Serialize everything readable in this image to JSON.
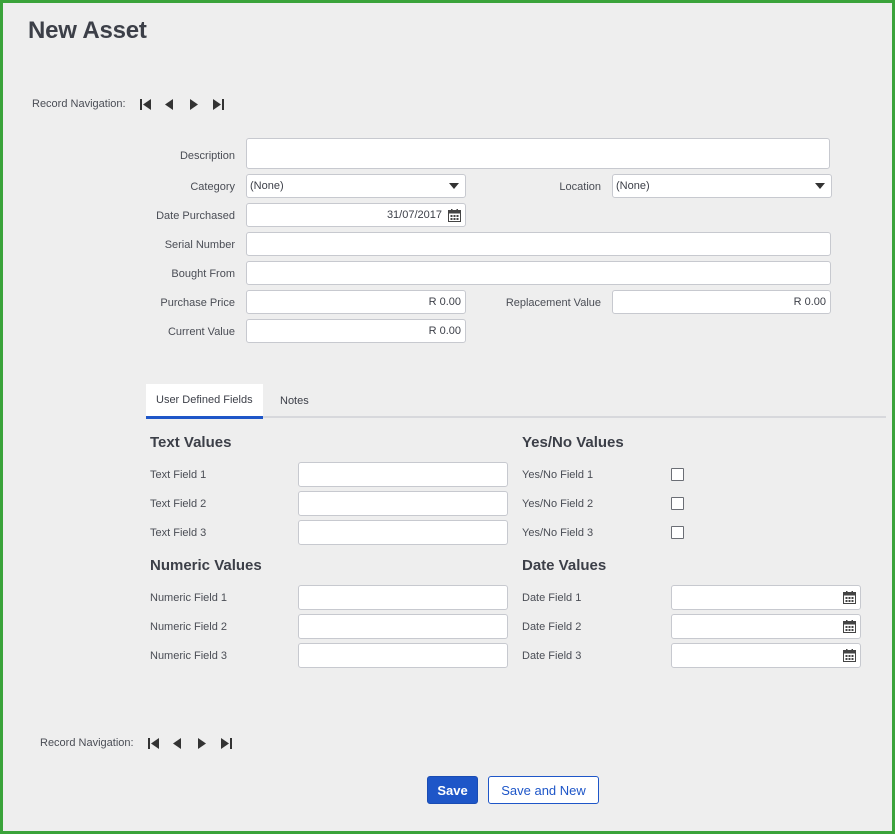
{
  "page": {
    "title": "New Asset"
  },
  "record_navigation": {
    "label": "Record Navigation:",
    "buttons": [
      "first-record-icon",
      "previous-record-icon",
      "next-record-icon",
      "last-record-icon"
    ]
  },
  "form": {
    "description": {
      "label": "Description",
      "value": ""
    },
    "category": {
      "label": "Category",
      "value": "(None)"
    },
    "location": {
      "label": "Location",
      "value": "(None)"
    },
    "date_purchased": {
      "label": "Date Purchased",
      "value": "31/07/2017"
    },
    "serial_number": {
      "label": "Serial Number",
      "value": ""
    },
    "bought_from": {
      "label": "Bought From",
      "value": ""
    },
    "purchase_price": {
      "label": "Purchase Price",
      "value": "R 0.00"
    },
    "replacement_value": {
      "label": "Replacement Value",
      "value": "R 0.00"
    },
    "current_value": {
      "label": "Current Value",
      "value": "R 0.00"
    }
  },
  "tabs": [
    {
      "label": "User Defined Fields",
      "active": true
    },
    {
      "label": "Notes",
      "active": false
    }
  ],
  "user_defined": {
    "text_values": {
      "heading": "Text Values",
      "fields": [
        {
          "label": "Text Field 1",
          "value": ""
        },
        {
          "label": "Text Field 2",
          "value": ""
        },
        {
          "label": "Text Field 3",
          "value": ""
        }
      ]
    },
    "yes_no_values": {
      "heading": "Yes/No Values",
      "fields": [
        {
          "label": "Yes/No Field 1",
          "checked": false
        },
        {
          "label": "Yes/No Field 2",
          "checked": false
        },
        {
          "label": "Yes/No Field 3",
          "checked": false
        }
      ]
    },
    "numeric_values": {
      "heading": "Numeric Values",
      "fields": [
        {
          "label": "Numeric Field 1",
          "value": ""
        },
        {
          "label": "Numeric Field 2",
          "value": ""
        },
        {
          "label": "Numeric Field 3",
          "value": ""
        }
      ]
    },
    "date_values": {
      "heading": "Date Values",
      "fields": [
        {
          "label": "Date Field 1",
          "value": ""
        },
        {
          "label": "Date Field 2",
          "value": ""
        },
        {
          "label": "Date Field 3",
          "value": ""
        }
      ]
    }
  },
  "actions": {
    "save_label": "Save",
    "save_new_label": "Save and New"
  },
  "colors": {
    "accent": "#1e56c8",
    "frame_border": "#3aa33a",
    "background": "#eeeeee"
  }
}
